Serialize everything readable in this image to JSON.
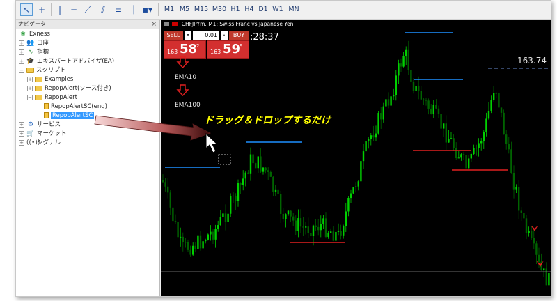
{
  "toolbar": {
    "timeframes": [
      "M1",
      "M5",
      "M15",
      "M30",
      "H1",
      "H4",
      "D1",
      "W1",
      "MN"
    ]
  },
  "navigator": {
    "title": "ナビゲータ",
    "close": "×",
    "items": [
      {
        "label": "Exness"
      },
      {
        "label": "口座"
      },
      {
        "label": "指標"
      },
      {
        "label": "エキスパートアドバイザ(EA)"
      },
      {
        "label": "スクリプト"
      },
      {
        "label": "Examples"
      },
      {
        "label": "RepopAlert(ソース付き)"
      },
      {
        "label": "RepopAlert"
      },
      {
        "label": "RepopAlertSC(eng)"
      },
      {
        "label": "RepopAlertSC"
      },
      {
        "label": "サービス"
      },
      {
        "label": "マーケット"
      },
      {
        "label": "シグナル"
      }
    ]
  },
  "chart": {
    "header": "CHFJPYm, M1:  Swiss Franc vs Japanese Yen",
    "sell_label": "SELL",
    "buy_label": "BUY",
    "lot": "0.01",
    "sell_price_prefix": "163",
    "sell_price_big": "58",
    "sell_price_sup": "2",
    "buy_price_prefix": "163",
    "buy_price_big": "59",
    "buy_price_sup": "9",
    "timer": ":28:37",
    "price_label": "163.74",
    "ema10": "EMA10",
    "ema100": "EMA100",
    "annotation": "ドラッグ＆ドロップするだけ",
    "colors": {
      "bull": "#00d000",
      "bear": "#006400",
      "resistance": "#1e90ff",
      "support": "#e02020"
    }
  }
}
